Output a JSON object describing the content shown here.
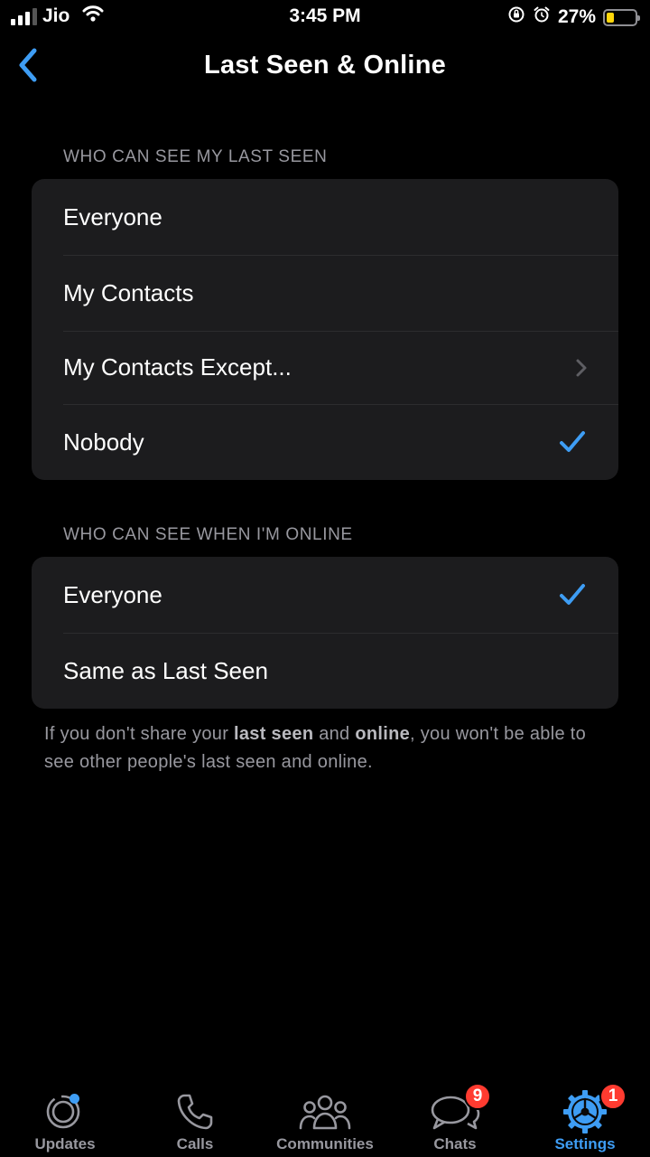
{
  "status_bar": {
    "carrier": "Jio",
    "time": "3:45 PM",
    "battery": "27%",
    "battery_level": 0.27,
    "icons": [
      "signal-icon",
      "wifi-icon",
      "orientation-lock-icon",
      "alarm-icon",
      "battery-icon"
    ]
  },
  "nav": {
    "title": "Last Seen & Online",
    "back_icon": "chevron-left-icon"
  },
  "last_seen": {
    "header": "WHO CAN SEE MY LAST SEEN",
    "options": [
      {
        "label": "Everyone",
        "selected": false
      },
      {
        "label": "My Contacts",
        "selected": false
      },
      {
        "label": "My Contacts Except...",
        "selected": false,
        "disclosure": true
      },
      {
        "label": "Nobody",
        "selected": true
      }
    ]
  },
  "online": {
    "header": "WHO CAN SEE WHEN I'M ONLINE",
    "options": [
      {
        "label": "Everyone",
        "selected": true
      },
      {
        "label": "Same as Last Seen",
        "selected": false
      }
    ]
  },
  "footnote": {
    "part1": "If you don't share your ",
    "bold1": "last seen",
    "part2": " and ",
    "bold2": "online",
    "part3": ", you won't be able to see other people's last seen and online."
  },
  "tabs": [
    {
      "label": "Updates",
      "icon": "updates-icon",
      "active": false,
      "badge": "",
      "dot": true
    },
    {
      "label": "Calls",
      "icon": "phone-icon",
      "active": false,
      "badge": ""
    },
    {
      "label": "Communities",
      "icon": "communities-icon",
      "active": false,
      "badge": ""
    },
    {
      "label": "Chats",
      "icon": "chats-icon",
      "active": false,
      "badge": "9"
    },
    {
      "label": "Settings",
      "icon": "settings-gear-icon",
      "active": true,
      "badge": "1"
    }
  ],
  "colors": {
    "accent": "#3e9df4",
    "background": "#000000",
    "cell": "#1c1c1e",
    "badge": "#ff3b30"
  }
}
